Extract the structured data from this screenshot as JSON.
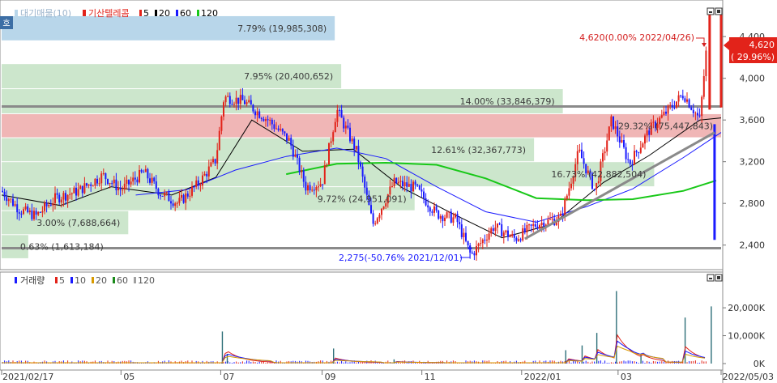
{
  "legend": {
    "corner_label": "호",
    "title": "대기매물(10)",
    "stock_name": "기산텔레콤",
    "mas": [
      {
        "label": "5",
        "color": "#e2231a"
      },
      {
        "label": "20",
        "color": "#000000"
      },
      {
        "label": "60",
        "color": "#1a1aff"
      },
      {
        "label": "120",
        "color": "#18c818"
      }
    ]
  },
  "volume_legend": {
    "title": "거래량",
    "mas": [
      {
        "label": "5",
        "color": "#e2231a"
      },
      {
        "label": "10",
        "color": "#1a1aff"
      },
      {
        "label": "20",
        "color": "#d89a00"
      },
      {
        "label": "60",
        "color": "#1a8a1a"
      },
      {
        "label": "120",
        "color": "#a0a0a0"
      }
    ]
  },
  "price_badge": {
    "price": "4,620",
    "change": "( 29.96%)"
  },
  "annotations": {
    "high": "4,620(0.00% 2022/04/26)",
    "low": "2,275(-50.76% 2021/12/01)"
  },
  "chart_data": [
    {
      "type": "candlestick",
      "title": "기산텔레콤",
      "y_ticks": [
        2400,
        2800,
        3200,
        3600,
        4000,
        4400
      ],
      "y_tick_labels": [
        "2,400",
        "2,800",
        "3,200",
        "3,600",
        "4,000",
        "4,400"
      ],
      "ylim": [
        2180,
        4720
      ],
      "x_range": [
        "2021/02/17",
        "2022/05/03"
      ],
      "x_tick_labels": [
        "2021/02/17",
        "05",
        "07",
        "09",
        "11",
        "2022/01",
        "03",
        "2022/05/03"
      ],
      "x_tick_dates": [
        "2021-02-17",
        "2021-05-01",
        "2021-07-01",
        "2021-09-01",
        "2021-11-01",
        "2022-01-01",
        "2022-03-01",
        "2022-05-03"
      ],
      "last_price": 4620,
      "last_change_pct": 29.96,
      "high": {
        "price": 4620,
        "change_pct": 0.0,
        "date": "2022/04/26"
      },
      "low": {
        "price": 2275,
        "change_pct": -50.76,
        "date": "2021/12/01"
      },
      "horizontal_lines": [
        3730,
        2370
      ],
      "trendline": {
        "from": [
          "2022-01-03",
          2460
        ],
        "to": [
          "2022-04-29",
          3480
        ]
      },
      "supply_profile": [
        {
          "lo": 4360,
          "hi": 4600,
          "label": "7.79% (19,985,308)",
          "width": 0.463,
          "color": "#b8d6ea"
        },
        {
          "lo": 3900,
          "hi": 4140,
          "label": "7.95% (20,400,652)",
          "width": 0.472,
          "color": "#cce6cc"
        },
        {
          "lo": 3660,
          "hi": 3900,
          "label": "14.00% (33,846,379)",
          "width": 0.78,
          "color": "#cce6cc"
        },
        {
          "lo": 3430,
          "hi": 3660,
          "label": "29.32% (75,447,843)",
          "width": 1.0,
          "color": "#f0b6b6"
        },
        {
          "lo": 3200,
          "hi": 3430,
          "label": "12.61% (32,367,773)",
          "width": 0.74,
          "color": "#cce6cc"
        },
        {
          "lo": 2960,
          "hi": 3200,
          "label": "16.73% (42,882,504)",
          "width": 0.907,
          "color": "#cce6cc"
        },
        {
          "lo": 2730,
          "hi": 2960,
          "label": "9.72% (24,951,091)",
          "width": 0.574,
          "color": "#cce6cc"
        },
        {
          "lo": 2500,
          "hi": 2730,
          "label": "3.00% (7,688,664)",
          "width": 0.176,
          "color": "#cce6cc"
        },
        {
          "lo": 2270,
          "hi": 2500,
          "label": "0.63% (1,613,184)",
          "width": 0.037,
          "color": "#cce6cc"
        }
      ],
      "close_path": [
        [
          "2021-02-17",
          2920
        ],
        [
          "2021-02-28",
          2740
        ],
        [
          "2021-03-10",
          2680
        ],
        [
          "2021-03-22",
          2850
        ],
        [
          "2021-04-05",
          2920
        ],
        [
          "2021-04-20",
          3070
        ],
        [
          "2021-05-01",
          2930
        ],
        [
          "2021-05-15",
          3100
        ],
        [
          "2021-05-25",
          2900
        ],
        [
          "2021-06-05",
          2800
        ],
        [
          "2021-06-18",
          3000
        ],
        [
          "2021-06-28",
          3220
        ],
        [
          "2021-07-03",
          3820
        ],
        [
          "2021-07-15",
          3780
        ],
        [
          "2021-07-30",
          3600
        ],
        [
          "2021-08-12",
          3400
        ],
        [
          "2021-08-22",
          2960
        ],
        [
          "2021-09-01",
          3000
        ],
        [
          "2021-09-10",
          3700
        ],
        [
          "2021-09-22",
          3300
        ],
        [
          "2021-10-02",
          2600
        ],
        [
          "2021-10-15",
          3000
        ],
        [
          "2021-10-28",
          2950
        ],
        [
          "2021-11-10",
          2700
        ],
        [
          "2021-11-22",
          2650
        ],
        [
          "2021-12-01",
          2300
        ],
        [
          "2021-12-15",
          2580
        ],
        [
          "2021-12-28",
          2460
        ],
        [
          "2022-01-10",
          2600
        ],
        [
          "2022-01-25",
          2660
        ],
        [
          "2022-02-05",
          3300
        ],
        [
          "2022-02-15",
          2920
        ],
        [
          "2022-02-25",
          3600
        ],
        [
          "2022-03-08",
          3180
        ],
        [
          "2022-03-20",
          3500
        ],
        [
          "2022-04-01",
          3700
        ],
        [
          "2022-04-10",
          3850
        ],
        [
          "2022-04-20",
          3600
        ],
        [
          "2022-04-26",
          4620
        ],
        [
          "2022-05-03",
          4620
        ]
      ],
      "ma_lines": [
        {
          "label": "20",
          "color": "#000000",
          "points": [
            [
              "2021-02-17",
              2880
            ],
            [
              "2021-03-25",
              2780
            ],
            [
              "2021-04-25",
              2960
            ],
            [
              "2021-06-01",
              2880
            ],
            [
              "2021-06-28",
              3050
            ],
            [
              "2021-07-20",
              3600
            ],
            [
              "2021-08-20",
              3300
            ],
            [
              "2021-09-20",
              3320
            ],
            [
              "2021-10-20",
              2950
            ],
            [
              "2021-11-20",
              2700
            ],
            [
              "2021-12-20",
              2470
            ],
            [
              "2022-01-20",
              2600
            ],
            [
              "2022-02-20",
              3000
            ],
            [
              "2022-03-20",
              3260
            ],
            [
              "2022-04-20",
              3600
            ],
            [
              "2022-05-03",
              3620
            ]
          ]
        },
        {
          "label": "60",
          "color": "#1a1aff",
          "points": [
            [
              "2021-05-10",
              2880
            ],
            [
              "2021-06-10",
              2930
            ],
            [
              "2021-07-10",
              3120
            ],
            [
              "2021-08-10",
              3250
            ],
            [
              "2021-09-10",
              3330
            ],
            [
              "2021-10-10",
              3230
            ],
            [
              "2021-11-10",
              2960
            ],
            [
              "2021-12-10",
              2720
            ],
            [
              "2022-01-10",
              2620
            ],
            [
              "2022-02-10",
              2770
            ],
            [
              "2022-03-10",
              2940
            ],
            [
              "2022-04-10",
              3240
            ],
            [
              "2022-05-03",
              3480
            ]
          ]
        },
        {
          "label": "120",
          "color": "#18c818",
          "points": [
            [
              "2021-08-10",
              3080
            ],
            [
              "2021-09-10",
              3180
            ],
            [
              "2021-10-10",
              3190
            ],
            [
              "2021-11-10",
              3170
            ],
            [
              "2021-12-10",
              3040
            ],
            [
              "2022-01-10",
              2850
            ],
            [
              "2022-02-10",
              2830
            ],
            [
              "2022-03-10",
              2840
            ],
            [
              "2022-04-10",
              2920
            ],
            [
              "2022-04-30",
              3020
            ]
          ]
        }
      ]
    },
    {
      "type": "bar",
      "title": "거래량",
      "y_ticks": [
        0,
        10000,
        20000
      ],
      "y_tick_labels": [
        "0K",
        "10,000K",
        "20,000K"
      ],
      "ylim": [
        0,
        27000
      ],
      "spikes": [
        [
          "2021-07-02",
          11500
        ],
        [
          "2021-07-05",
          3500
        ],
        [
          "2021-09-08",
          5400
        ],
        [
          "2021-10-15",
          1500
        ],
        [
          "2022-01-28",
          4800
        ],
        [
          "2022-02-07",
          6500
        ],
        [
          "2022-02-16",
          11000
        ],
        [
          "2022-02-28",
          26000
        ],
        [
          "2022-03-15",
          3200
        ],
        [
          "2022-04-11",
          16500
        ],
        [
          "2022-04-27",
          20500
        ]
      ]
    }
  ]
}
